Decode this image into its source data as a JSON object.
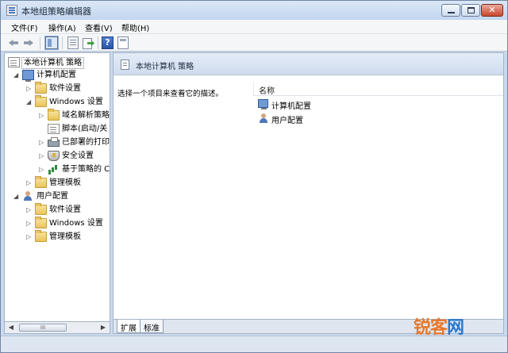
{
  "window": {
    "title": "本地组策略编辑器"
  },
  "menubar": {
    "items": [
      "文件(F)",
      "操作(A)",
      "查看(V)",
      "帮助(H)"
    ]
  },
  "toolbar": {
    "icons": [
      "back-arrow-icon",
      "forward-arrow-icon",
      "show-hide-tree-icon",
      "properties-icon",
      "export-list-icon",
      "help-icon",
      "filter-icon"
    ],
    "help_glyph": "?"
  },
  "tree": {
    "root": "本地计算机 策略",
    "items": [
      {
        "label": "计算机配置",
        "toggle": "◢",
        "icon": "computer-icon"
      },
      {
        "label": "软件设置",
        "toggle": "▷",
        "icon": "folder-icon"
      },
      {
        "label": "Windows 设置",
        "toggle": "◢",
        "icon": "folder-icon"
      },
      {
        "label": "域名解析策略",
        "toggle": "▷",
        "icon": "folder-icon"
      },
      {
        "label": "脚本(启动/关",
        "toggle": "",
        "icon": "script-icon"
      },
      {
        "label": "已部署的打印",
        "toggle": "▷",
        "icon": "printer-icon"
      },
      {
        "label": "安全设置",
        "toggle": "▷",
        "icon": "shield-icon"
      },
      {
        "label": "基于策略的 C",
        "toggle": "▷",
        "icon": "chart-icon"
      },
      {
        "label": "管理模板",
        "toggle": "▷",
        "icon": "folder-icon"
      },
      {
        "label": "用户配置",
        "toggle": "◢",
        "icon": "user-icon"
      },
      {
        "label": "软件设置",
        "toggle": "▷",
        "icon": "folder-icon"
      },
      {
        "label": "Windows 设置",
        "toggle": "▷",
        "icon": "folder-icon"
      },
      {
        "label": "管理模板",
        "toggle": "▷",
        "icon": "folder-icon"
      }
    ],
    "scroll_left": "◀",
    "scroll_right": "▶",
    "scroll_grip": "III"
  },
  "content": {
    "header": "本地计算机 策略",
    "description": "选择一个项目来查看它的描述。",
    "column_name": "名称",
    "rows": [
      {
        "label": "计算机配置",
        "icon": "computer-icon"
      },
      {
        "label": "用户配置",
        "icon": "user-icon"
      }
    ]
  },
  "tabs": [
    {
      "label": "扩展"
    },
    {
      "label": "标准"
    }
  ],
  "watermark": {
    "part1": "锐客",
    "part2": "网"
  }
}
